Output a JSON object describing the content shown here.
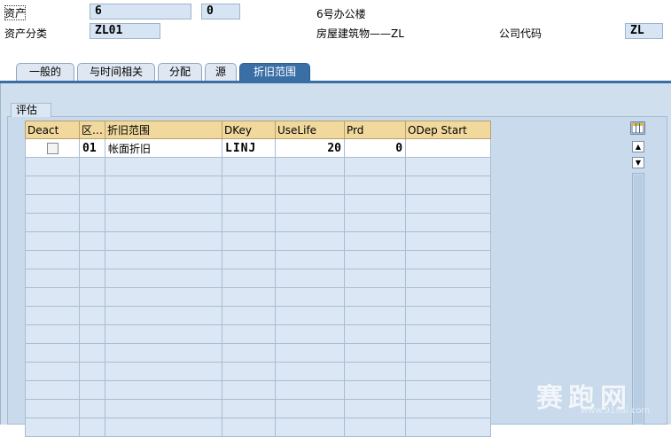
{
  "header": {
    "asset_label": "资产",
    "asset_number": "6",
    "asset_subnumber": "0",
    "asset_description": "6号办公楼",
    "asset_class_label": "资产分类",
    "asset_class": "ZL01",
    "asset_class_description": "房屋建筑物——ZL",
    "company_code_label": "公司代码",
    "company_code": "ZL"
  },
  "tabs": [
    {
      "label": "一般的"
    },
    {
      "label": "与时间相关"
    },
    {
      "label": "分配"
    },
    {
      "label": "源"
    },
    {
      "label": "折旧范围"
    }
  ],
  "active_tab": "折旧范围",
  "group": {
    "title": "评估"
  },
  "table": {
    "columns": [
      "Deact",
      "区…",
      "折旧范围",
      "DKey",
      "UseLife",
      "Prd",
      "ODep Start"
    ],
    "rows": [
      {
        "deact": false,
        "area": "01",
        "name": "帐面折旧",
        "dkey": "LINJ",
        "uselife": "20",
        "prd": "0",
        "odep_start": ""
      }
    ]
  },
  "watermark": {
    "main": "赛跑网",
    "sub": "www.91sai.com"
  }
}
